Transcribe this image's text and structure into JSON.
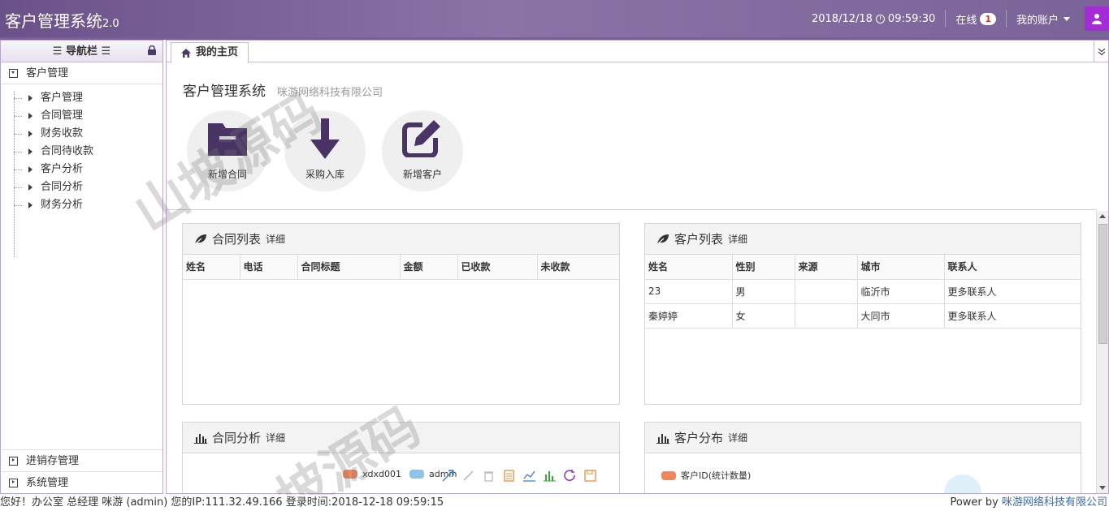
{
  "header": {
    "title": "客户管理系统",
    "version": "2.0",
    "datetime": "2018/12/18",
    "time": "09:59:30",
    "online_label": "在线",
    "online_count": "1",
    "account_label": "我的账户"
  },
  "sidebar": {
    "title": "导航栏",
    "group_customer": "客户管理",
    "items": [
      "客户管理",
      "合同管理",
      "财务收款",
      "合同待收款",
      "客户分析",
      "合同分析",
      "财务分析"
    ],
    "bottom_groups": [
      "进销存管理",
      "系统管理"
    ]
  },
  "tabs": [
    {
      "label": "我的主页"
    }
  ],
  "welcome": {
    "system": "客户管理系统",
    "company": "咪游网络科技有限公司"
  },
  "quick_actions": [
    {
      "label": "新增合同",
      "icon": "folder-icon"
    },
    {
      "label": "采购入库",
      "icon": "arrow-down-icon"
    },
    {
      "label": "新增客户",
      "icon": "edit-icon"
    }
  ],
  "panels": {
    "contracts": {
      "title": "合同列表",
      "detail": "详细",
      "columns": [
        "姓名",
        "电话",
        "合同标题",
        "金额",
        "已收款",
        "未收款"
      ],
      "rows": []
    },
    "customers": {
      "title": "客户列表",
      "detail": "详细",
      "columns": [
        "姓名",
        "性别",
        "来源",
        "城市",
        "联系人"
      ],
      "rows": [
        [
          "23",
          "男",
          "",
          "临沂市",
          "更多联系人"
        ],
        [
          "秦婷婷",
          "女",
          "",
          "大同市",
          "更多联系人"
        ]
      ]
    },
    "contract_analysis": {
      "title": "合同分析",
      "detail": "详细",
      "legend": [
        {
          "name": "xdxd001",
          "color": "#f0875a"
        },
        {
          "name": "admin",
          "color": "#8ec3ea"
        }
      ]
    },
    "customer_distribution": {
      "title": "客户分布",
      "detail": "详细",
      "legend": [
        {
          "name": "客户ID(统计数量)",
          "color": "#f0875a"
        }
      ]
    }
  },
  "footer": {
    "left": "您好！办公室 总经理 咪游 (admin) 您的IP:111.32.49.166 登录时间:2018-12-18 09:59:15",
    "power_label": "Power by",
    "power_company": "咪游网络科技有限公司"
  },
  "theme": {
    "header_color": "#6b5189",
    "accent": "#5a3f7c",
    "user_button": "#a42cd6"
  }
}
